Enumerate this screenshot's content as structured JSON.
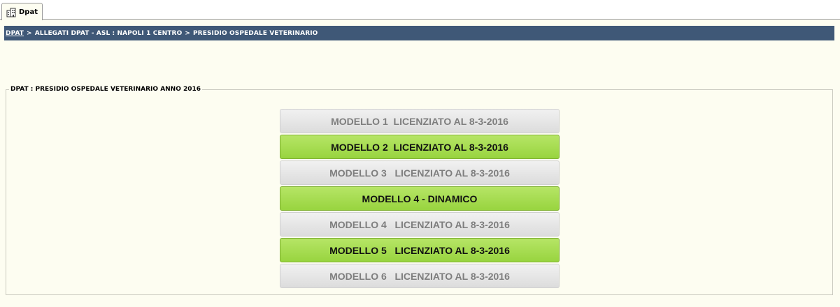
{
  "tab": {
    "label": "Dpat"
  },
  "breadcrumb": {
    "link": "DPAT",
    "separator": ">",
    "items": [
      "ALLEGATI DPAT - ASL : NAPOLI 1 CENTRO",
      "PRESIDIO OSPEDALE VETERINARIO"
    ]
  },
  "panel": {
    "legend": "DPAT : PRESIDIO OSPEDALE VETERINARIO ANNO 2016",
    "buttons": [
      {
        "label": "MODELLO 1  LICENZIATO AL 8-3-2016",
        "style": "grey"
      },
      {
        "label": "MODELLO 2  LICENZIATO AL 8-3-2016",
        "style": "green"
      },
      {
        "label": "MODELLO 3   LICENZIATO AL 8-3-2016",
        "style": "grey"
      },
      {
        "label": "MODELLO 4 - DINAMICO",
        "style": "green"
      },
      {
        "label": "MODELLO 4   LICENZIATO AL 8-3-2016",
        "style": "grey"
      },
      {
        "label": "MODELLO 5   LICENZIATO AL 8-3-2016",
        "style": "green"
      },
      {
        "label": "MODELLO 6   LICENZIATO AL 8-3-2016",
        "style": "grey"
      }
    ]
  },
  "colors": {
    "breadcrumb_bg": "#3f5877",
    "page_bg": "#fdfdf1",
    "button_green": "#a8dd55",
    "button_grey": "#e6e6e6"
  },
  "icons": {
    "tab": "building-icon"
  }
}
